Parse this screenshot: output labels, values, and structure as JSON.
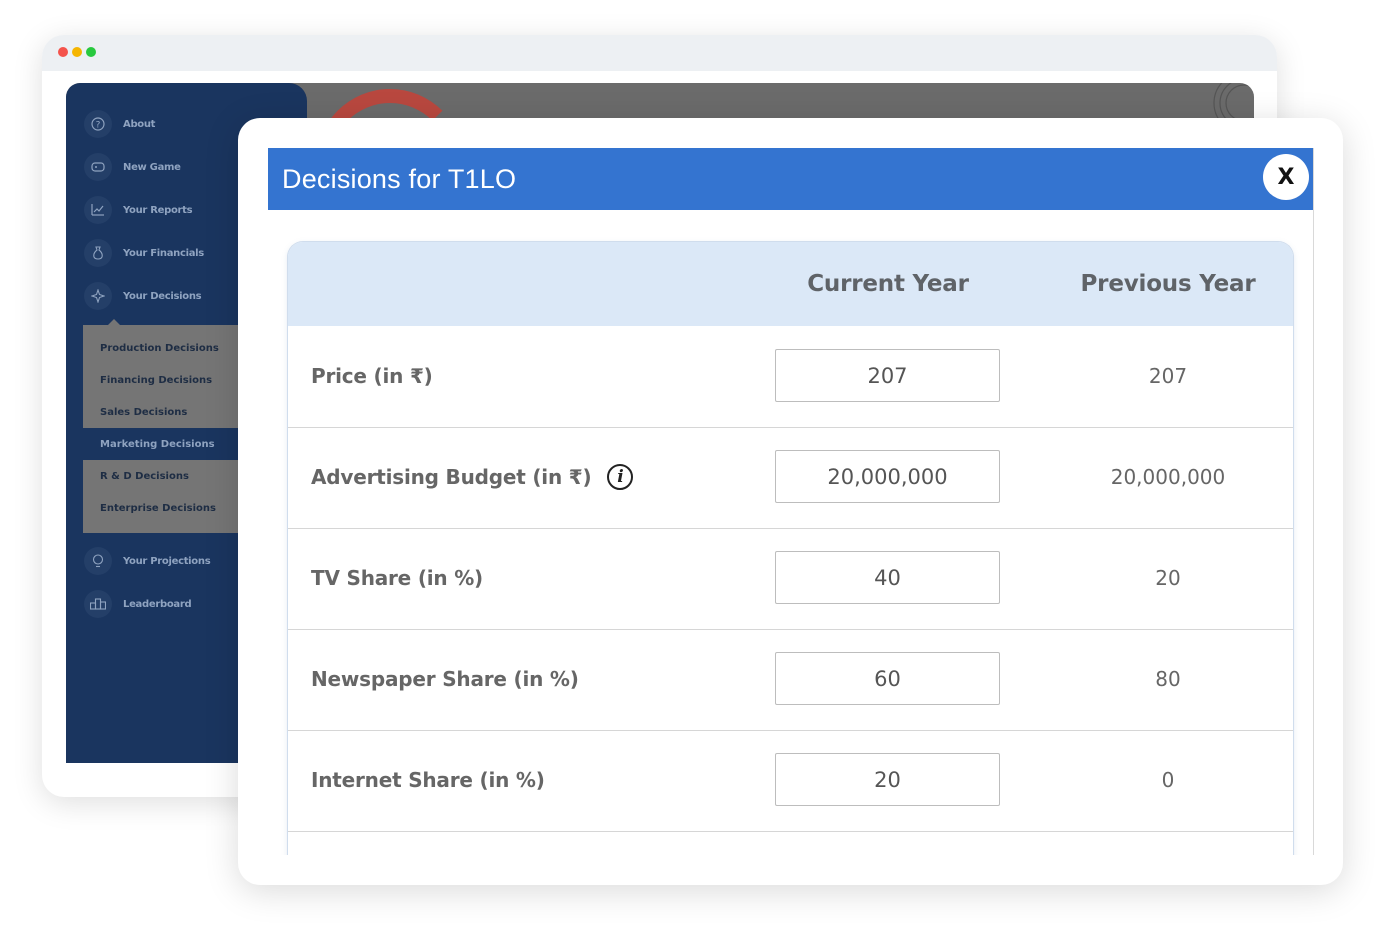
{
  "sidebar": {
    "items": [
      {
        "label": "About",
        "icon": "question-icon"
      },
      {
        "label": "New Game",
        "icon": "gamepad-icon"
      },
      {
        "label": "Your Reports",
        "icon": "chart-line-icon"
      },
      {
        "label": "Your Financials",
        "icon": "money-bag-icon"
      },
      {
        "label": "Your Decisions",
        "icon": "compass-icon"
      },
      {
        "label": "Your Projections",
        "icon": "lightbulb-icon"
      },
      {
        "label": "Leaderboard",
        "icon": "podium-icon"
      }
    ],
    "submenu": [
      {
        "label": "Production Decisions",
        "active": false
      },
      {
        "label": "Financing Decisions",
        "active": false
      },
      {
        "label": "Sales Decisions",
        "active": false
      },
      {
        "label": "Marketing Decisions",
        "active": true
      },
      {
        "label": "R & D Decisions",
        "active": false
      },
      {
        "label": "Enterprise Decisions",
        "active": false
      }
    ]
  },
  "modal": {
    "title": "Decisions for T1LO",
    "close_label": "X",
    "columns": {
      "current": "Current Year",
      "previous": "Previous Year"
    },
    "rows": [
      {
        "label": "Price (in ₹)",
        "current": "207",
        "previous": "207",
        "info": false
      },
      {
        "label": "Advertising Budget (in ₹)",
        "current": "20,000,000",
        "previous": "20,000,000",
        "info": true
      },
      {
        "label": "TV Share (in %)",
        "current": "40",
        "previous": "20",
        "info": false
      },
      {
        "label": "Newspaper Share (in %)",
        "current": "60",
        "previous": "80",
        "info": false
      },
      {
        "label": "Internet Share (in %)",
        "current": "20",
        "previous": "0",
        "info": false
      }
    ],
    "info_glyph": "i"
  },
  "colors": {
    "header_blue": "#3474d0",
    "sidebar_navy": "#1a355f",
    "table_header": "#dbe8f7"
  }
}
